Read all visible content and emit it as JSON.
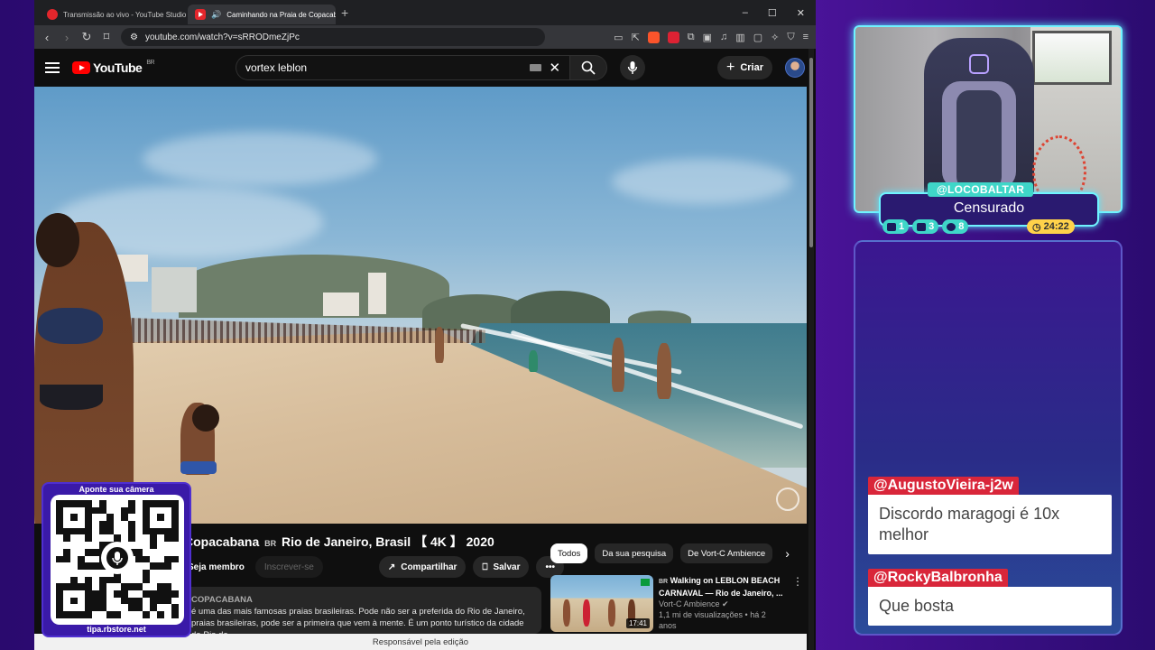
{
  "browser": {
    "tabs": [
      {
        "title": "Transmissão ao vivo - YouTube Studio",
        "active": false
      },
      {
        "title": "Caminhando na Praia de Copacabana",
        "active": true
      }
    ],
    "new_tab_label": "+",
    "window_controls": [
      "–",
      "☐",
      "✕"
    ],
    "url": "youtube.com/watch?v=sRRODmeZjPc",
    "status_bar": "Responsável pela edição"
  },
  "youtube": {
    "logo_text": "YouTube",
    "logo_region": "BR",
    "search_value": "vortex leblon",
    "create_label": "Criar",
    "video": {
      "title_prefix": "Copacabana",
      "title_tag": "BR",
      "title_suffix": "Rio de Janeiro, Brasil 【 4K 】 2020",
      "join_label": "Seja membro",
      "subscribe_label": "Inscrever-se",
      "share_label": "Compartilhar",
      "save_label": "Salvar",
      "more_label": "•••",
      "description_channel": "COPACABANA",
      "description_line1": "é uma das mais famosas praias brasileiras. Pode não ser a preferida do Rio de Janeiro,",
      "description_line2": "praias brasileiras, pode ser a primeira que vem à mente. É um ponto turístico da cidade do Rio de"
    },
    "chips": [
      "Todos",
      "Da sua pesquisa",
      "De Vort-C Ambience"
    ],
    "recommendation": {
      "tag": "BR",
      "title": "Walking on LEBLON BEACH CARNAVAL — Rio de Janeiro, ...",
      "channel": "Vort-C Ambience",
      "views": "1,1 mi de visualizações",
      "age": "há 2 anos",
      "duration": "17:41"
    }
  },
  "qr_overlay": {
    "top_text": "Aponte sua câmera",
    "bottom_text": "tipa.rbstore.net"
  },
  "stream": {
    "handle": "@LOCOBALTAR",
    "status": "Censurado",
    "counters": [
      {
        "icon": "twitch-icon",
        "value": "1"
      },
      {
        "icon": "youtube-icon",
        "value": "3"
      },
      {
        "icon": "kick-icon",
        "value": "8"
      }
    ],
    "timer": "24:22",
    "chat": [
      {
        "user": "@AugustoVieira-j2w",
        "text": "Discordo maragogi é 10x melhor"
      },
      {
        "user": "@RockyBalbronha",
        "text": "Que bosta"
      }
    ]
  },
  "colors": {
    "accent_cyan": "#6ff3ff",
    "chat_user_red": "#d9263a",
    "timer_yellow": "#ffd24a",
    "youtube_red": "#ff0000"
  }
}
